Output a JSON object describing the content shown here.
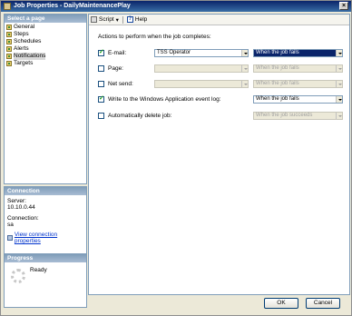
{
  "window": {
    "title": "Job Properties - DailyMaintenancePlay",
    "close_label": "×"
  },
  "left": {
    "select_page_header": "Select a page",
    "pages": [
      {
        "label": "General"
      },
      {
        "label": "Steps"
      },
      {
        "label": "Schedules"
      },
      {
        "label": "Alerts"
      },
      {
        "label": "Notifications"
      },
      {
        "label": "Targets"
      }
    ],
    "connection_header": "Connection",
    "server_label": "Server:",
    "server_value": "10.10.0.44",
    "connection_label": "Connection:",
    "connection_value": "sa",
    "view_link": "View connection properties",
    "progress_header": "Progress",
    "progress_status": "Ready"
  },
  "toolbar": {
    "script_label": "Script",
    "help_label": "Help"
  },
  "content": {
    "actions_title": "Actions to perform when the job completes:",
    "rows": [
      {
        "label": "E-mail:",
        "checked": true,
        "operator": "TSS Operator",
        "condition": "When the job fails"
      },
      {
        "label": "Page:",
        "checked": false,
        "operator": "",
        "condition": "When the job fails"
      },
      {
        "label": "Net send:",
        "checked": false,
        "operator": "",
        "condition": "When the job fails"
      },
      {
        "label": "Write to the Windows Application event log:",
        "checked": true,
        "condition": "When the job fails"
      },
      {
        "label": "Automatically delete job:",
        "checked": false,
        "condition": "When the job succeeds"
      }
    ]
  },
  "buttons": {
    "ok": "OK",
    "cancel": "Cancel"
  }
}
